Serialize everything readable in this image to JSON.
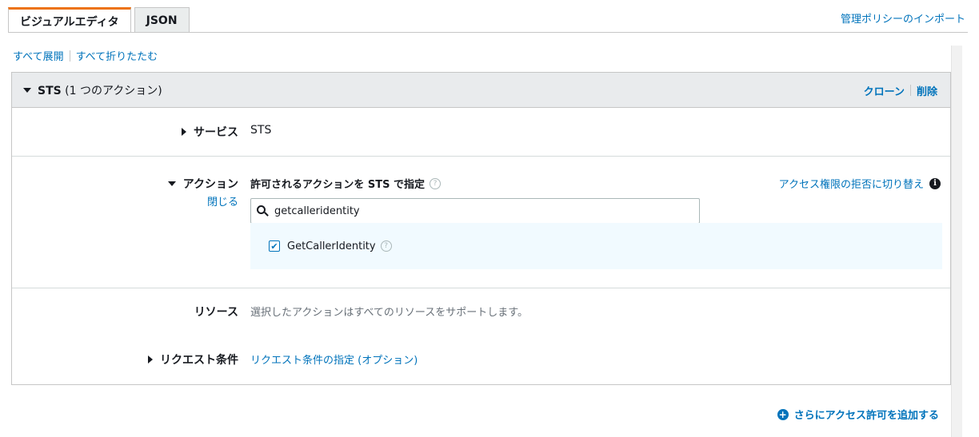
{
  "tabs": {
    "visual_editor": "ビジュアルエディタ",
    "json": "JSON"
  },
  "import_link": "管理ポリシーのインポート",
  "expand_all": "すべて展開",
  "collapse_all": "すべて折りたたむ",
  "panel": {
    "service_name": "STS",
    "action_count": "(1 つのアクション)",
    "clone": "クローン",
    "delete": "削除"
  },
  "service_row": {
    "label": "サービス",
    "value": "STS"
  },
  "actions_row": {
    "label": "アクション",
    "close": "閉じる",
    "heading": "許可されるアクションを STS で指定",
    "deny_switch": "アクセス権限の拒否に切り替え",
    "search_value": "getcalleridentity",
    "result_label": "GetCallerIdentity",
    "result_checked": true
  },
  "resources_row": {
    "label": "リソース",
    "value": "選択したアクションはすべてのリソースをサポートします。"
  },
  "conditions_row": {
    "label": "リクエスト条件",
    "link": "リクエスト条件の指定 (オプション)"
  },
  "add_permission": "さらにアクセス許可を追加する",
  "colors": {
    "link": "#0073bb",
    "tab_accent": "#ec7211",
    "header_bg": "#e9ebed",
    "result_bg": "#f1faff"
  }
}
